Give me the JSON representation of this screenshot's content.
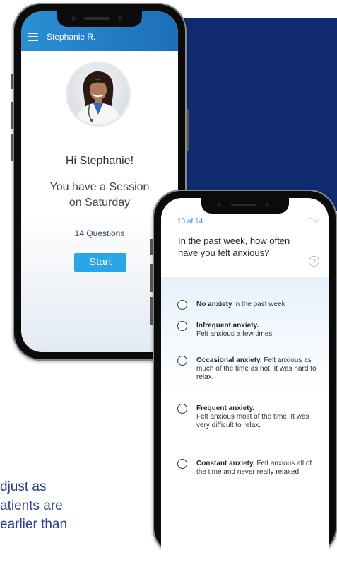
{
  "background": {
    "marketing_text_lines": [
      "djust as",
      "atients are",
      "earlier than"
    ]
  },
  "phone1": {
    "header": {
      "user_name": "Stephanie R."
    },
    "greeting": "Hi Stephanie!",
    "session_line1": "You have a Session",
    "session_line2": "on Saturday",
    "questions_count": "14 Questions",
    "start_label": "Start"
  },
  "phone2": {
    "progress": "10 of 14",
    "exit_label": "Exit",
    "question": "In the past week, how often have you felt anxious?",
    "help_icon_glyph": "?",
    "options": [
      {
        "bold": "No anxiety",
        "text": " in the past week"
      },
      {
        "bold": "Infrequent anxiety.",
        "text": "Felt anxious a few times."
      },
      {
        "bold": "Occasional anxiety.",
        "text": " Felt anxious as much of the time as not. It was hard to relax."
      },
      {
        "bold": "Frequent anxiety.",
        "text": "Felt anxious most of the time. It was very difficult to relax."
      },
      {
        "bold": "Constant anxiety.",
        "text": " Felt anxious all of the time and never really relaxed."
      }
    ]
  },
  "colors": {
    "navy_panel": "#0f2a6e",
    "header_blue": "#1d6fb7",
    "start_button": "#2aa6e8",
    "progress_text": "#2a9ae0",
    "marketing_text": "#2d3b8f"
  }
}
